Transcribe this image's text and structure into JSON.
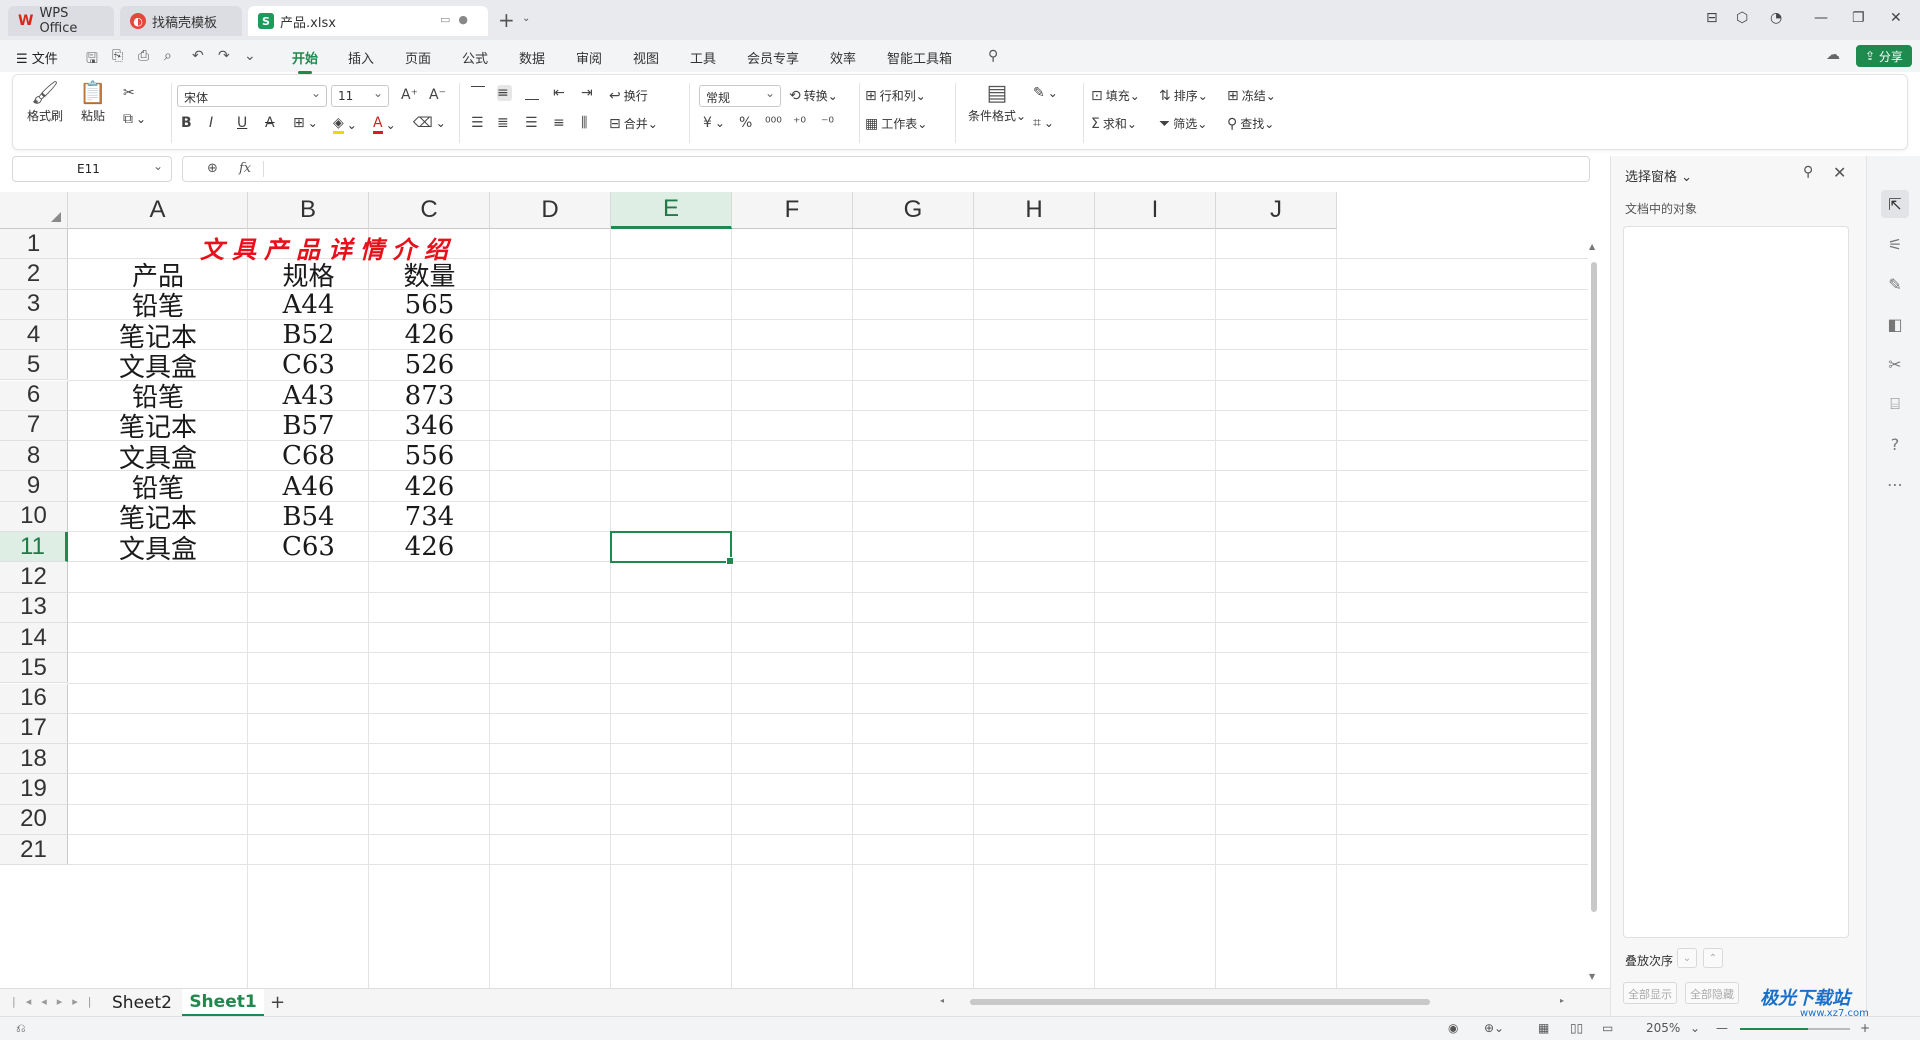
{
  "titlebar": {
    "tabs": [
      {
        "label": "WPS Office",
        "icon": "wps-logo-icon"
      },
      {
        "label": "找稿壳模板",
        "icon": "template-icon"
      },
      {
        "label": "产品.xlsx",
        "icon": "spreadsheet-icon"
      }
    ],
    "file_tab_glyph": "S"
  },
  "menubar": {
    "file_label": "文件",
    "items": [
      "开始",
      "插入",
      "页面",
      "公式",
      "数据",
      "审阅",
      "视图",
      "工具",
      "会员专享",
      "效率",
      "智能工具箱"
    ],
    "active": "开始",
    "share_label": "分享"
  },
  "ribbon": {
    "format_painter": "格式刷",
    "paste": "粘贴",
    "font_name": "宋体",
    "font_size": "11",
    "wrap": "换行",
    "merge": "合并",
    "number_format": "常规",
    "convert": "转换",
    "rows_cols": "行和列",
    "worksheet": "工作表",
    "cond_format": "条件格式",
    "fill": "填充",
    "sort": "排序",
    "freeze": "冻结",
    "sum": "求和",
    "filter": "筛选",
    "find": "查找"
  },
  "formula_bar": {
    "name_box": "E11",
    "fx_label": "fx",
    "formula": ""
  },
  "sheet": {
    "columns": [
      "A",
      "B",
      "C",
      "D",
      "E",
      "F",
      "G",
      "H",
      "I",
      "J"
    ],
    "selected_column": "E",
    "rows": [
      "1",
      "2",
      "3",
      "4",
      "5",
      "6",
      "7",
      "8",
      "9",
      "10",
      "11",
      "12",
      "13",
      "14",
      "15",
      "16",
      "17",
      "18",
      "19",
      "20",
      "21"
    ],
    "selected_row": "11",
    "title": "文具产品详情介绍",
    "headers": [
      "产品",
      "规格",
      "数量"
    ],
    "data": [
      [
        "铅笔",
        "A44",
        "565"
      ],
      [
        "笔记本",
        "B52",
        "426"
      ],
      [
        "文具盒",
        "C63",
        "526"
      ],
      [
        "铅笔",
        "A43",
        "873"
      ],
      [
        "笔记本",
        "B57",
        "346"
      ],
      [
        "文具盒",
        "C68",
        "556"
      ],
      [
        "铅笔",
        "A46",
        "426"
      ],
      [
        "笔记本",
        "B54",
        "734"
      ],
      [
        "文具盒",
        "C63",
        "426"
      ]
    ],
    "title_color": "#e8101a"
  },
  "sheet_tabs": {
    "tabs": [
      "Sheet2",
      "Sheet1"
    ],
    "active": "Sheet1"
  },
  "selection_pane": {
    "title": "选择窗格",
    "objects_label": "文档中的对象",
    "order_label": "叠放次序",
    "show_all": "全部显示",
    "hide_all": "全部隐藏"
  },
  "statusbar": {
    "zoom": "205%",
    "zoom_fraction": 0.62
  },
  "watermark": {
    "text": "极光下载站",
    "sub": "www.xz7.com"
  },
  "colors": {
    "accent": "#1e8a4d",
    "selected_header_bg": "#dfeee4"
  }
}
